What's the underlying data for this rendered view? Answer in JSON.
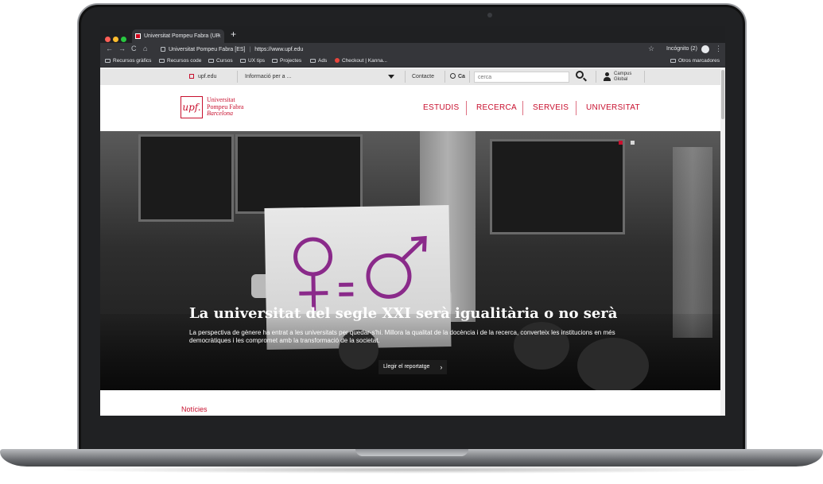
{
  "browser": {
    "tab_title": "Universitat Pompeu Fabra (UP",
    "tab_close": "×",
    "new_tab": "+",
    "nav_back": "←",
    "nav_forward": "→",
    "nav_reload": "C",
    "nav_home": "⌂",
    "site_name": "Universitat Pompeu Fabra [ES]",
    "separator": "|",
    "url": "https://www.upf.edu",
    "star": "☆",
    "incognito_label": "Incógnito (2)",
    "menu": "⋮",
    "bookmarks": [
      "Recursos gràfics",
      "Recursos code",
      "Cursos",
      "UX tips",
      "Projectes",
      "Ads",
      "Checkout | Kanna..."
    ],
    "other_bookmarks": "Otros marcadores"
  },
  "utility": {
    "home_link": "upf.edu",
    "info_select": "Informació per a ...",
    "contact": "Contacte",
    "language": "Ca",
    "search_placeholder": "cerca",
    "campus_line1": "Campus",
    "campus_line2": "Global"
  },
  "header": {
    "logo_mark": "upf.",
    "logo_line1": "Universitat",
    "logo_line2": "Pompeu Fabra",
    "logo_line3": "Barcelona",
    "nav": [
      "ESTUDIS",
      "RECERCA",
      "SERVEIS",
      "UNIVERSITAT"
    ]
  },
  "hero": {
    "title": "La universitat del segle XXI serà igualitària o no serà",
    "description": "La perspectiva de gènere ha entrat a les universitats per quedar-s'hi. Millora la qualitat de la docència i de la recerca, converteix les institucions en més democràtiques i les compromet amb la transformació de la societat.",
    "button_label": "Llegir el reportatge",
    "button_chevron": "›",
    "sign_equals": "=",
    "slides_total": 2,
    "active_slide": 1
  },
  "section": {
    "news_title": "Notícies"
  },
  "colors": {
    "brand_red": "#c8102e",
    "chrome_dark": "#35363a",
    "sign_ink": "#8a2a8a"
  }
}
